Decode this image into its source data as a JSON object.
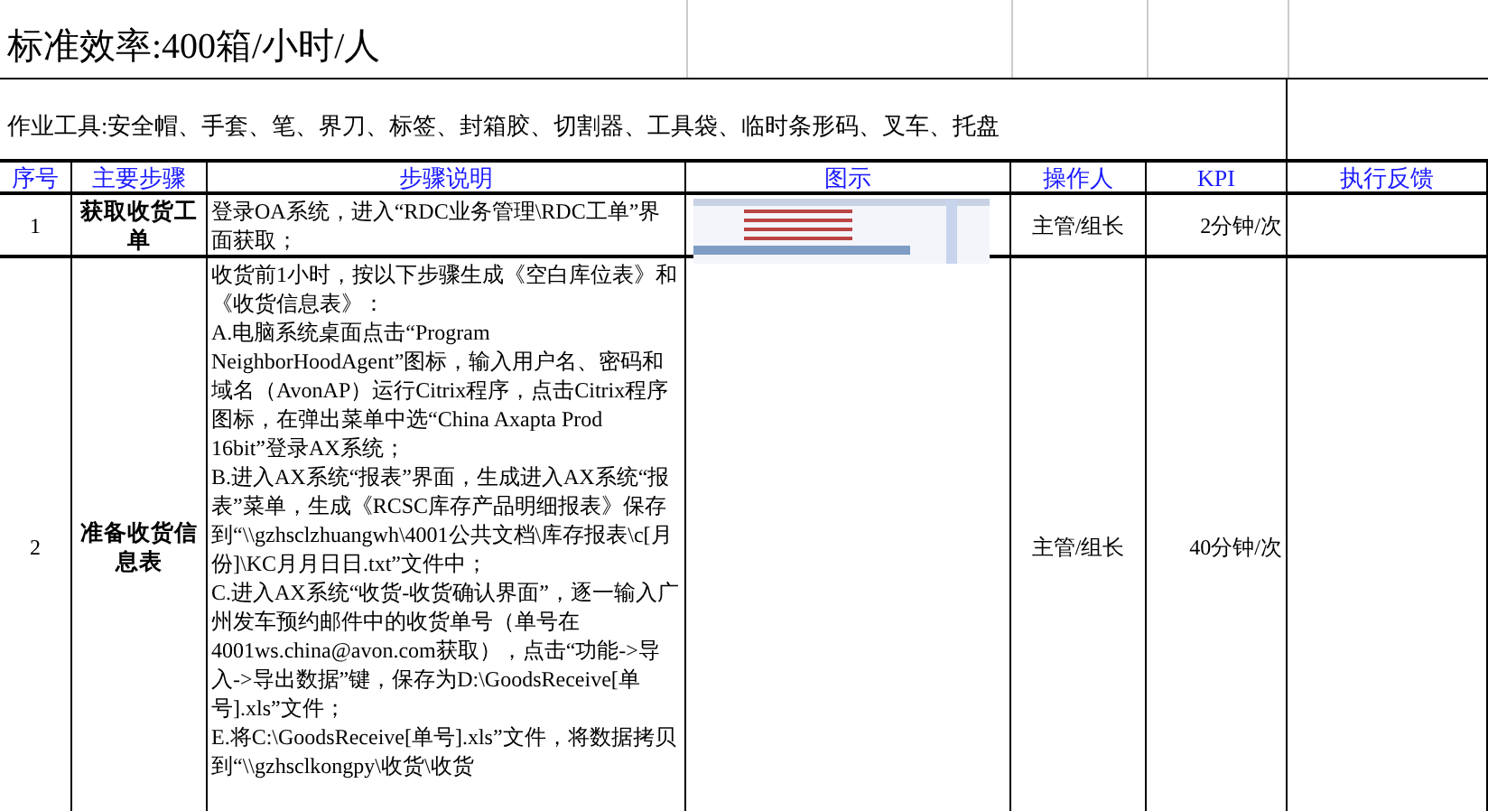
{
  "title": "标准效率:400箱/小时/人",
  "tools": "作业工具:安全帽、手套、笔、界刀、标签、封箱胶、切割器、工具袋、临时条形码、叉车、托盘",
  "table": {
    "columns": [
      "序号",
      "主要步骤",
      "步骤说明",
      "图示",
      "操作人",
      "KPI",
      "执行反馈"
    ],
    "rows": [
      {
        "number": "1",
        "step": "获取收货工单",
        "description": [
          "登录OA系统，进入“RDC业务管理\\RDC工单”界面获取；"
        ],
        "operator": "主管/组长",
        "kpi": "2分钟/次"
      },
      {
        "number": "2",
        "step": "准备收货信息表",
        "description": [
          "收货前1小时，按以下步骤生成《空白库位表》和《收货信息表》：",
          "A.电脑系统桌面点击“Program NeighborHoodAgent”图标，输入用户名、密码和域名（AvonAP）运行Citrix程序，点击Citrix程序图标，在弹出菜单中选“China Axapta Prod 16bit”登录AX系统；",
          "B.进入AX系统“报表”界面，生成进入AX系统“报表”菜单，生成《RCSC库存产品明细报表》保存到“\\\\gzhsclzhuangwh\\4001公共文档\\库存报表\\c[月份]\\KC月月日日.txt”文件中；",
          "C.进入AX系统“收货-收货确认界面”，逐一输入广州发车预约邮件中的收货单号（单号在4001ws.china@avon.com获取），点击“功能->导入->导出数据”键，保存为D:\\GoodsReceive[单号].xls”文件；",
          "E.将C:\\GoodsReceive[单号].xls”文件，将数据拷贝到“\\\\gzhsclkongpy\\收货\\收货"
        ],
        "operator": "主管/组长",
        "kpi": "40分钟/次"
      }
    ]
  }
}
